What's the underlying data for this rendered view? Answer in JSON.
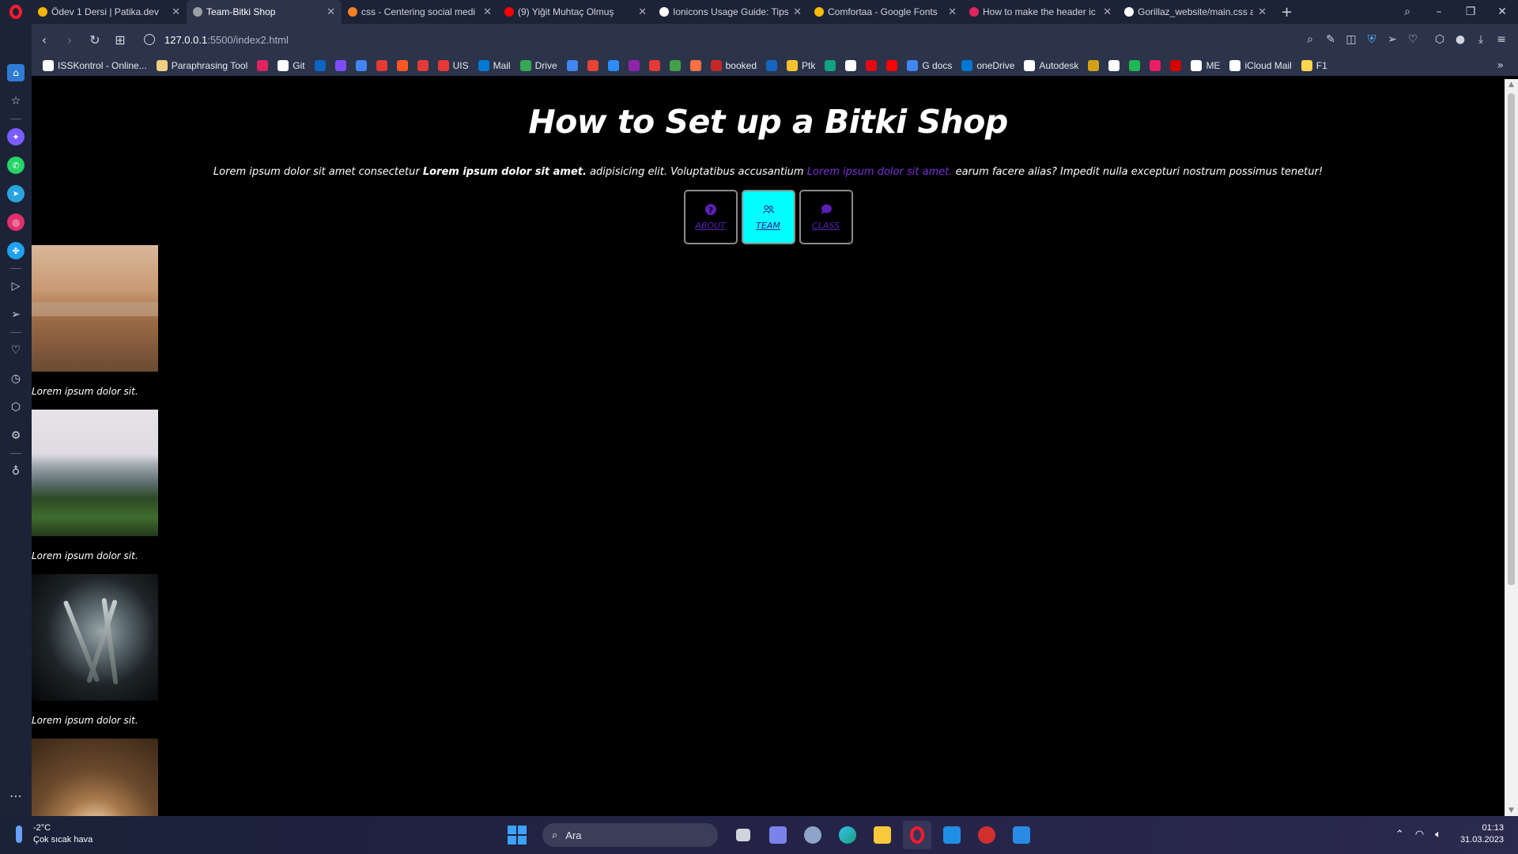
{
  "browser": {
    "tabs": [
      {
        "title": "Ödev 1 Dersi | Patika.dev",
        "fav": "#f5b50a",
        "active": false
      },
      {
        "title": "Team-Bitki Shop",
        "fav": "#9aa0a6",
        "active": true
      },
      {
        "title": "css - Centering social medi",
        "fav": "#f48024",
        "active": false
      },
      {
        "title": "(9) Yiğit Muhtaç Olmuş",
        "fav": "#ff0000",
        "active": false
      },
      {
        "title": "Ionicons Usage Guide: Tips",
        "fav": "#ffffff",
        "active": false
      },
      {
        "title": "Comfortaa - Google Fonts",
        "fav": "#fbbc04",
        "active": false
      },
      {
        "title": "How to make the header ic",
        "fav": "#e0245e",
        "active": false
      },
      {
        "title": "Gorillaz_website/main.css a",
        "fav": "#ffffff",
        "active": false
      }
    ],
    "new_tab": "+",
    "url_host": "127.0.0.1",
    "url_path": ":5500/index2.html",
    "bookmarks": [
      {
        "label": "ISSKontrol - Online...",
        "color": "#ffffff"
      },
      {
        "label": "Paraphrasing Tool",
        "color": "#f0d080"
      },
      {
        "label": "",
        "color": "#e0245e"
      },
      {
        "label": "Git",
        "color": "#ffffff"
      },
      {
        "label": "",
        "color": "#0a66c2"
      },
      {
        "label": "",
        "color": "#7c4dff"
      },
      {
        "label": "",
        "color": "#4285f4"
      },
      {
        "label": "",
        "color": "#e53935"
      },
      {
        "label": "",
        "color": "#ff5722"
      },
      {
        "label": "",
        "color": "#e53935"
      },
      {
        "label": "UIS",
        "color": "#e53935"
      },
      {
        "label": "Mail",
        "color": "#0078d4"
      },
      {
        "label": "Drive",
        "color": "#34a853"
      },
      {
        "label": "",
        "color": "#4285f4"
      },
      {
        "label": "",
        "color": "#ea4335"
      },
      {
        "label": "",
        "color": "#2d8cff"
      },
      {
        "label": "",
        "color": "#8e24aa"
      },
      {
        "label": "",
        "color": "#e53935"
      },
      {
        "label": "",
        "color": "#43a047"
      },
      {
        "label": "",
        "color": "#ff7043"
      },
      {
        "label": "booked",
        "color": "#c62828"
      },
      {
        "label": "",
        "color": "#1565c0"
      },
      {
        "label": "Ptk",
        "color": "#fbc02d"
      },
      {
        "label": "",
        "color": "#10a37f"
      },
      {
        "label": "",
        "color": "#ffffff"
      },
      {
        "label": "",
        "color": "#e50914"
      },
      {
        "label": "",
        "color": "#ff0000"
      },
      {
        "label": "G docs",
        "color": "#4285f4"
      },
      {
        "label": "oneDrive",
        "color": "#0078d4"
      },
      {
        "label": "Autodesk",
        "color": "#ffffff"
      },
      {
        "label": "",
        "color": "#d4a017"
      },
      {
        "label": "",
        "color": "#ffffff"
      },
      {
        "label": "",
        "color": "#1db954"
      },
      {
        "label": "",
        "color": "#e91e63"
      },
      {
        "label": "",
        "color": "#d50000"
      },
      {
        "label": "ME",
        "color": "#ffffff"
      },
      {
        "label": "iCloud Mail",
        "color": "#ffffff"
      },
      {
        "label": "F1",
        "color": "#ffd54f"
      }
    ],
    "bookmarks_more": "»"
  },
  "page": {
    "title": "How to Set up a Bitki Shop",
    "lead": {
      "part1": "Lorem ipsum dolor sit amet consectetur ",
      "bold": "Lorem ipsum dolor sit amet.",
      "part2": " adipisicing elit. Voluptatibus accusantium ",
      "link": "Lorem ipsum dolor sit amet.",
      "part3": " earum facere alias? Impedit nulla excepturi nostrum possimus tenetur!"
    },
    "nav": [
      {
        "label": "ABOUT",
        "icon": "help-circle-icon",
        "active": false
      },
      {
        "label": "TEAM",
        "icon": "people-icon",
        "active": true
      },
      {
        "label": "CLASS",
        "icon": "chatbubbles-icon",
        "active": false
      }
    ],
    "gallery": [
      {
        "caption": "Lorem ipsum dolor sit.",
        "image": "desert-coast-photo"
      },
      {
        "caption": "Lorem ipsum dolor sit.",
        "image": "seaside-cliff-photo"
      },
      {
        "caption": "Lorem ipsum dolor sit.",
        "image": "forks-photo"
      },
      {
        "caption": "",
        "image": "tunnel-light-photo"
      }
    ]
  },
  "taskbar": {
    "weather_temp": "-2°C",
    "weather_desc": "Çok sıcak hava",
    "search_placeholder": "Ara",
    "time": "01:13",
    "date": "31.03.2023"
  },
  "colors": {
    "accent_active_button": "#00ffff",
    "link": "#7a2ed6",
    "browser_chrome": "#2b344a",
    "tabbar": "#1c2336"
  }
}
